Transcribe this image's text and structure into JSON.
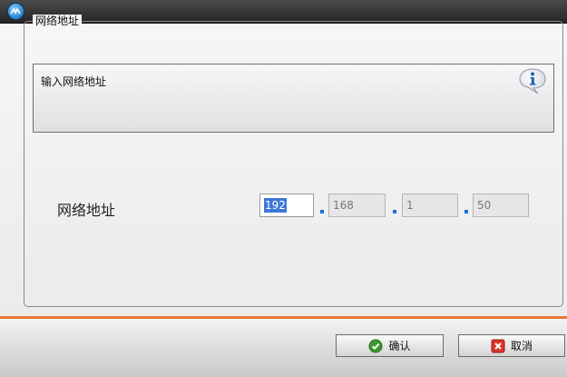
{
  "window": {
    "icon": "app-logo-icon"
  },
  "group": {
    "title": "网络地址"
  },
  "info": {
    "text": "输入网络地址",
    "icon": "info-icon"
  },
  "form": {
    "label": "网络地址",
    "ip": [
      "192",
      "168",
      "1",
      "50"
    ]
  },
  "buttons": {
    "ok": {
      "label": "确认",
      "icon": "check-icon"
    },
    "cancel": {
      "label": "取消",
      "icon": "close-icon"
    }
  },
  "colors": {
    "accent": "#e8782e",
    "titlebar": "#303030",
    "selection": "#3c78d8",
    "dot": "#1a6fd6"
  }
}
